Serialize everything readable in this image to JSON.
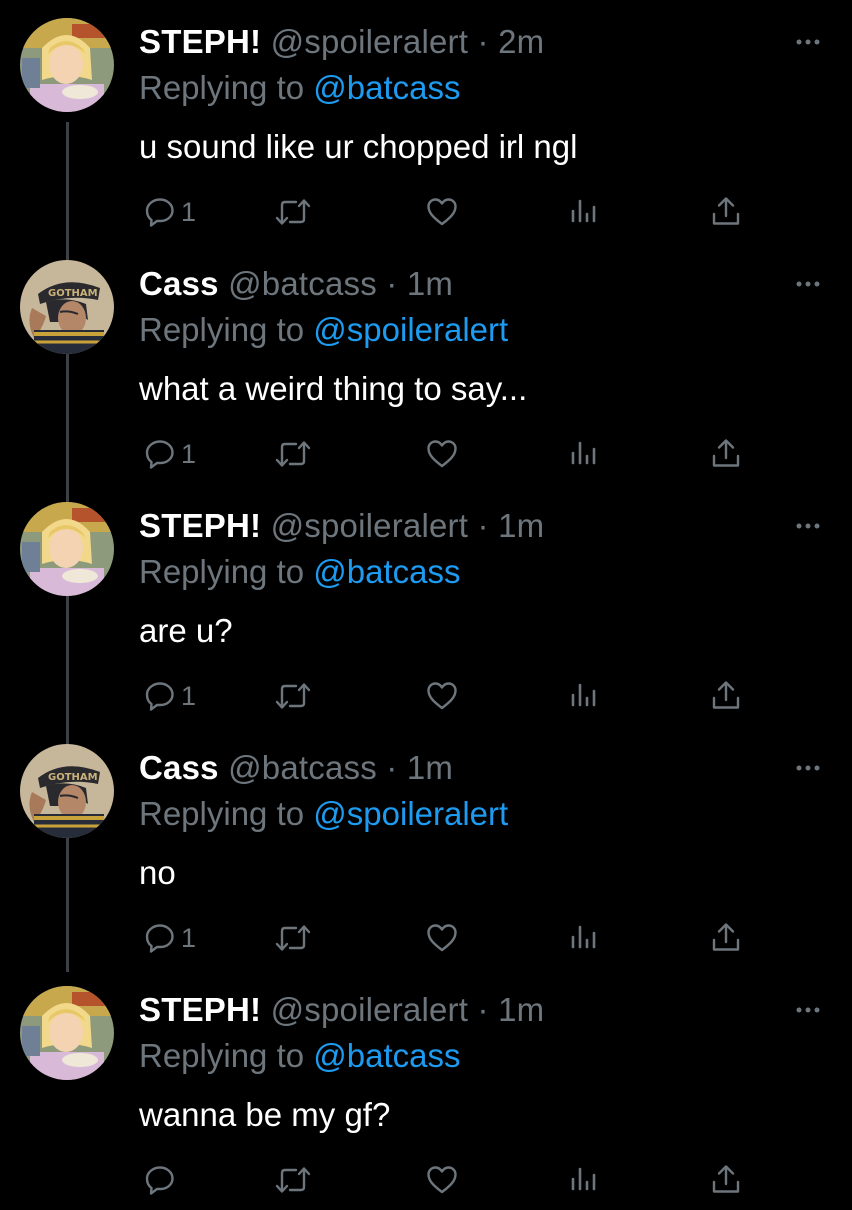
{
  "thread": {
    "tweets": [
      {
        "author": "STEPH!",
        "handle": "@spoileralert",
        "separator": "·",
        "time": "2m",
        "replying_prefix": "Replying to",
        "replying_to": "@batcass",
        "text": "u sound like ur chopped irl ngl",
        "reply_count": "1",
        "avatar": "steph-avatar-icon"
      },
      {
        "author": "Cass",
        "handle": "@batcass",
        "separator": "·",
        "time": "1m",
        "replying_prefix": "Replying to",
        "replying_to": "@spoileralert",
        "text": "what a weird thing to say...",
        "reply_count": "1",
        "avatar": "cass-avatar-icon"
      },
      {
        "author": "STEPH!",
        "handle": "@spoileralert",
        "separator": "·",
        "time": "1m",
        "replying_prefix": "Replying to",
        "replying_to": "@batcass",
        "text": "are u?",
        "reply_count": "1",
        "avatar": "steph-avatar-icon"
      },
      {
        "author": "Cass",
        "handle": "@batcass",
        "separator": "·",
        "time": "1m",
        "replying_prefix": "Replying to",
        "replying_to": "@spoileralert",
        "text": "no",
        "reply_count": "1",
        "avatar": "cass-avatar-icon"
      },
      {
        "author": "STEPH!",
        "handle": "@spoileralert",
        "separator": "·",
        "time": "1m",
        "replying_prefix": "Replying to",
        "replying_to": "@batcass",
        "text": "wanna be my gf?",
        "reply_count": "",
        "avatar": "steph-avatar-icon"
      }
    ]
  },
  "icons": {
    "reply": "reply-icon",
    "retweet": "retweet-icon",
    "like": "like-icon",
    "analytics": "analytics-icon",
    "share": "share-icon",
    "more": "more-icon"
  },
  "colors": {
    "background": "#000000",
    "primary_text": "#ffffff",
    "secondary_text": "#6e767d",
    "mention": "#1d9bf0",
    "thread_line": "#3d4146"
  }
}
